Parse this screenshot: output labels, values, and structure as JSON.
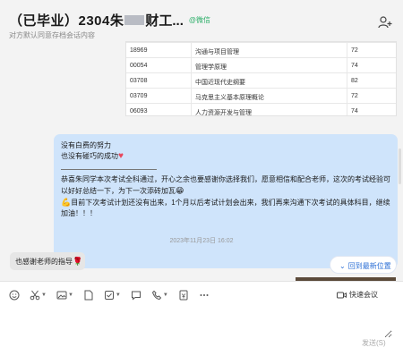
{
  "header": {
    "title_prefix": "（已毕业）2304朱",
    "title_suffix": "财工...",
    "source_tag": "@微信",
    "subtitle": "对方默认同意存档会话内容",
    "add_member_icon": "add-member-icon"
  },
  "grade_table": {
    "rows": [
      {
        "code": "18969",
        "course": "沟通与项目管理",
        "score": "72"
      },
      {
        "code": "00054",
        "course": "管理学原理",
        "score": "74"
      },
      {
        "code": "03708",
        "course": "中国近现代史纲要",
        "score": "82"
      },
      {
        "code": "03709",
        "course": "马克思主义基本原理概论",
        "score": "72"
      },
      {
        "code": "06093",
        "course": "人力资源开发与管理",
        "score": "74"
      }
    ]
  },
  "message": {
    "line1": "没有白费的努力",
    "line2": "也没有碰巧的成功",
    "para1": "恭喜朱同学本次考试全科通过，开心之余也要感谢你选择我们，愿意相信和配合老师，这次的考试经验可以好好总结一下，为下一次添砖加瓦",
    "para2": "目前下次考试计划还没有出来，1个月以后考试计划会出来，我们再来沟通下次考试的具体科目，继续加油！！！"
  },
  "timestamp": "2023年11月23日 16:02",
  "reply": {
    "text": "也感谢老师的指导"
  },
  "jump_button": {
    "label": "回到最新位置"
  },
  "toolbar": {
    "icons": [
      "emoji-icon",
      "scissors-icon",
      "image-icon",
      "file-icon",
      "todo-icon",
      "chat-record-icon",
      "phone-icon",
      "red-packet-icon",
      "more-icon"
    ],
    "meeting_label": "快速会议"
  },
  "input": {
    "value": "",
    "send_label": "发送(S)"
  },
  "colors": {
    "bubble": "#cfe4fb",
    "wechat_tag": "#2aae67",
    "link": "#2b6fd6"
  }
}
